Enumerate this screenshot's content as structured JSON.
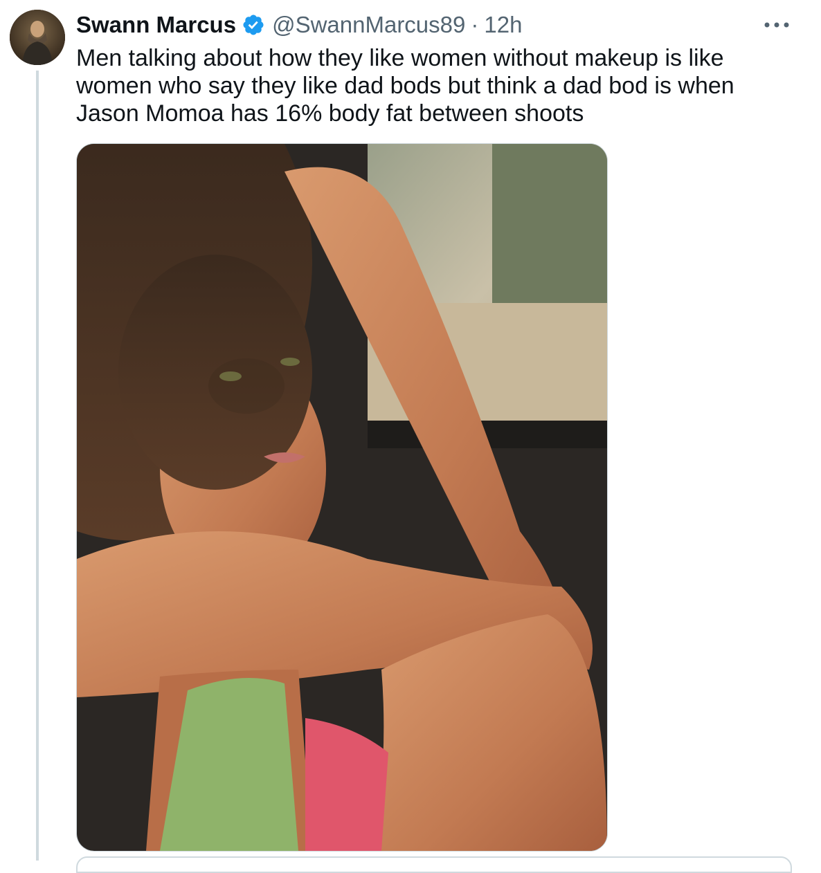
{
  "tweet": {
    "display_name": "Swann Marcus",
    "verified": true,
    "handle": "@SwannMarcus89",
    "separator": "·",
    "time": "12h",
    "text": "Men talking about how they like women without makeup is like\nwomen who say they like dad bods but think a dad bod is when\nJason Momoa has 16% body fat between shoots",
    "more_icon": "more-horizontal-icon",
    "avatar_icon": "avatar-portrait"
  },
  "media": {
    "kind": "photo"
  },
  "colors": {
    "verified": "#1d9bf0",
    "text": "#0f1419",
    "secondary": "#536471",
    "border": "#cfd9de"
  }
}
